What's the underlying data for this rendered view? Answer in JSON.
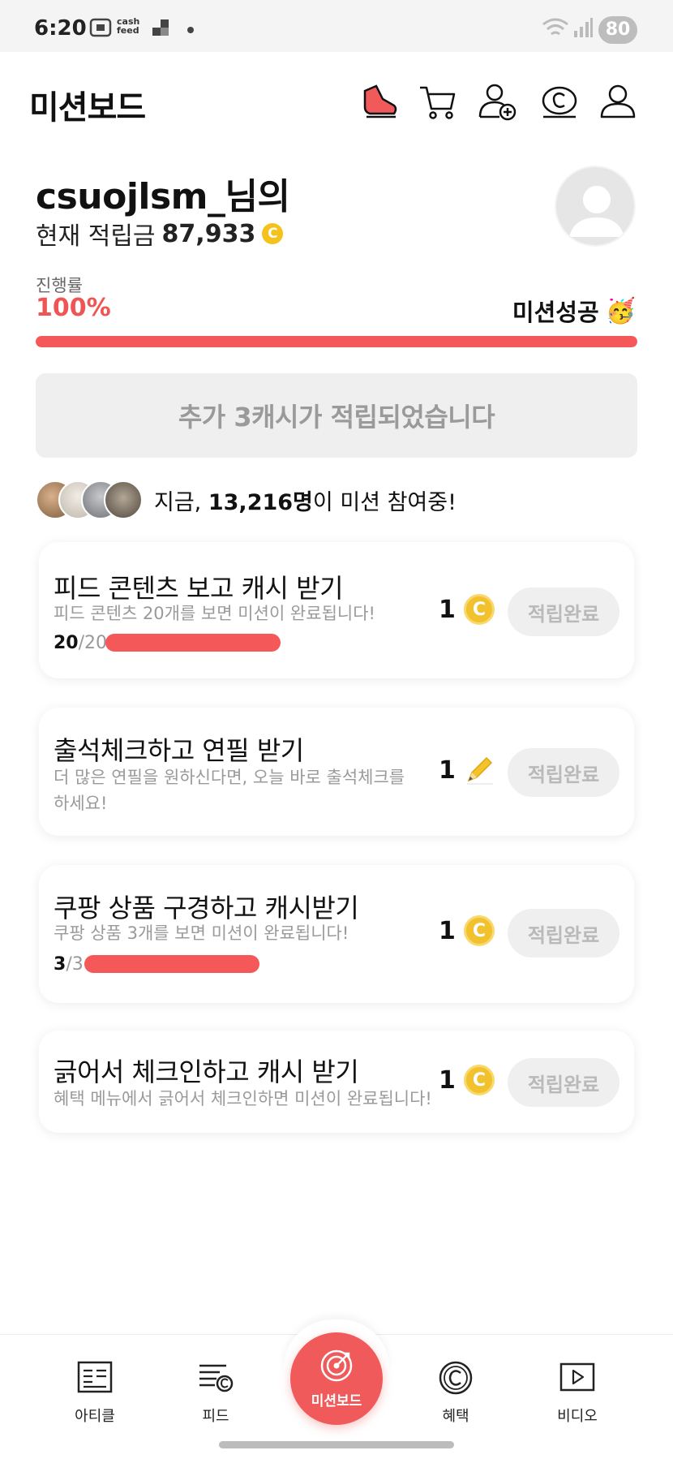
{
  "status_bar": {
    "time": "6:20",
    "battery": "80",
    "cash_feed_label": "cash feed"
  },
  "header": {
    "title": "미션보드",
    "icons": [
      "shoe-icon",
      "cart-icon",
      "add-friend-icon",
      "cash-icon",
      "profile-icon"
    ]
  },
  "user": {
    "name": "csuojlsm_님의",
    "balance_label": "현재 적립금",
    "balance": "87,933",
    "coin_symbol": "C"
  },
  "progress": {
    "label": "진행률",
    "value_text": "100%",
    "value": 1.0,
    "status": "미션성공",
    "status_emoji": "🥳"
  },
  "notice": {
    "text": "추가 3캐시가 적립되었습니다"
  },
  "participants": {
    "prefix": "지금, ",
    "count": "13,216명",
    "suffix": "이 미션 참여중!"
  },
  "missions": [
    {
      "title": "피드 콘텐츠 보고 캐시 받기",
      "desc": "피드 콘텐츠 20개를 보면 미션이 완료됩니다!",
      "done": "20",
      "total": "/20",
      "progress": 1.0,
      "reward": "1",
      "reward_icon": "coin-icon",
      "coin_symbol": "C",
      "button": "적립완료"
    },
    {
      "title": "출석체크하고 연필 받기",
      "desc": "더 많은 연필을 원하신다면, 오늘 바로 출석체크를 하세요!",
      "reward": "1",
      "reward_icon": "pencil-icon",
      "button": "적립완료"
    },
    {
      "title": "쿠팡 상품 구경하고 캐시받기",
      "desc": "쿠팡 상품 3개를 보면 미션이 완료됩니다!",
      "done": "3",
      "total": "/3",
      "progress": 1.0,
      "reward": "1",
      "reward_icon": "coin-icon",
      "coin_symbol": "C",
      "button": "적립완료"
    },
    {
      "title": "긁어서 체크인하고 캐시 받기",
      "desc": "혜택 메뉴에서 긁어서 체크인하면 미션이 완료됩니다!",
      "reward": "1",
      "reward_icon": "coin-icon",
      "coin_symbol": "C",
      "button": "적립완료"
    }
  ],
  "bottom_nav": {
    "items": [
      {
        "label": "아티클",
        "icon": "article-icon"
      },
      {
        "label": "피드",
        "icon": "feed-icon"
      },
      {
        "label": "미션보드",
        "icon": "target-icon",
        "active": true
      },
      {
        "label": "혜택",
        "icon": "benefit-icon"
      },
      {
        "label": "비디오",
        "icon": "video-icon"
      }
    ]
  },
  "colors": {
    "accent": "#f45858",
    "coin": "#f2c12e",
    "muted": "#9a9a9a"
  }
}
